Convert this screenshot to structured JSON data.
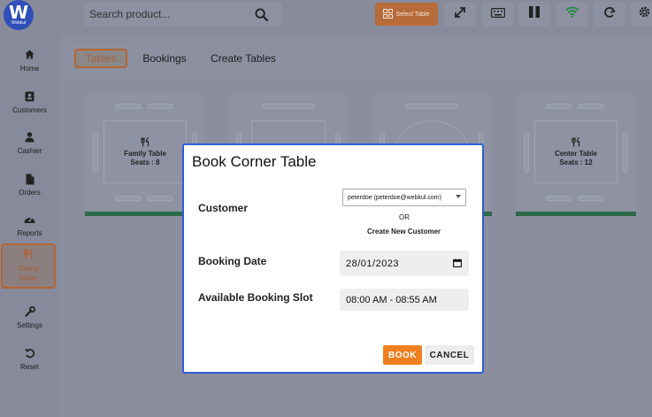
{
  "header": {
    "logo_text": "W",
    "logo_subtext": "Webkul",
    "search_placeholder": "Search product...",
    "select_table_label": "Select Table",
    "icons": [
      "search-icon",
      "table-grid-icon",
      "fullscreen-icon",
      "keyboard-icon",
      "pause-icon",
      "wifi-icon",
      "refresh-icon",
      "gear-icon"
    ]
  },
  "sidebar": {
    "items": [
      {
        "label": "Home",
        "icon": "home-icon"
      },
      {
        "label": "Customers",
        "icon": "customers-icon"
      },
      {
        "label": "Cashier",
        "icon": "cashier-icon"
      },
      {
        "label": "Orders",
        "icon": "orders-icon"
      },
      {
        "label": "Reports",
        "icon": "reports-icon"
      },
      {
        "label": "Dining Tables",
        "icon": "dining-tables-icon",
        "active": true
      },
      {
        "label": "Settings",
        "icon": "wrench-icon"
      },
      {
        "label": "Reset",
        "icon": "reset-icon"
      }
    ]
  },
  "tabs": [
    {
      "label": "Tables",
      "active": true
    },
    {
      "label": "Bookings"
    },
    {
      "label": "Create Tables"
    }
  ],
  "tables": [
    {
      "name": "Family Table",
      "seats": "Seats : 8"
    },
    {
      "name": "",
      "seats": ""
    },
    {
      "name": "",
      "seats": ""
    },
    {
      "name": "Center Table",
      "seats": "Seats : 12"
    }
  ],
  "modal": {
    "title": "Book Corner Table",
    "customer_label": "Customer",
    "customer_value": "peterdoe (peterdoe@webkul.com)",
    "or_text": "OR",
    "create_new_label": "Create New Customer",
    "booking_date_label": "Booking Date",
    "booking_date_value": "28/01/2023",
    "slot_label": "Available Booking Slot",
    "slot_value": "08:00 AM - 08:55 AM",
    "book_button": "BOOK",
    "cancel_button": "CANCEL"
  },
  "colors": {
    "accent": "#f07f20",
    "modal_border": "#2f5dd6",
    "active_outline": "#b26533",
    "status_bar": "#2c6a4a"
  }
}
